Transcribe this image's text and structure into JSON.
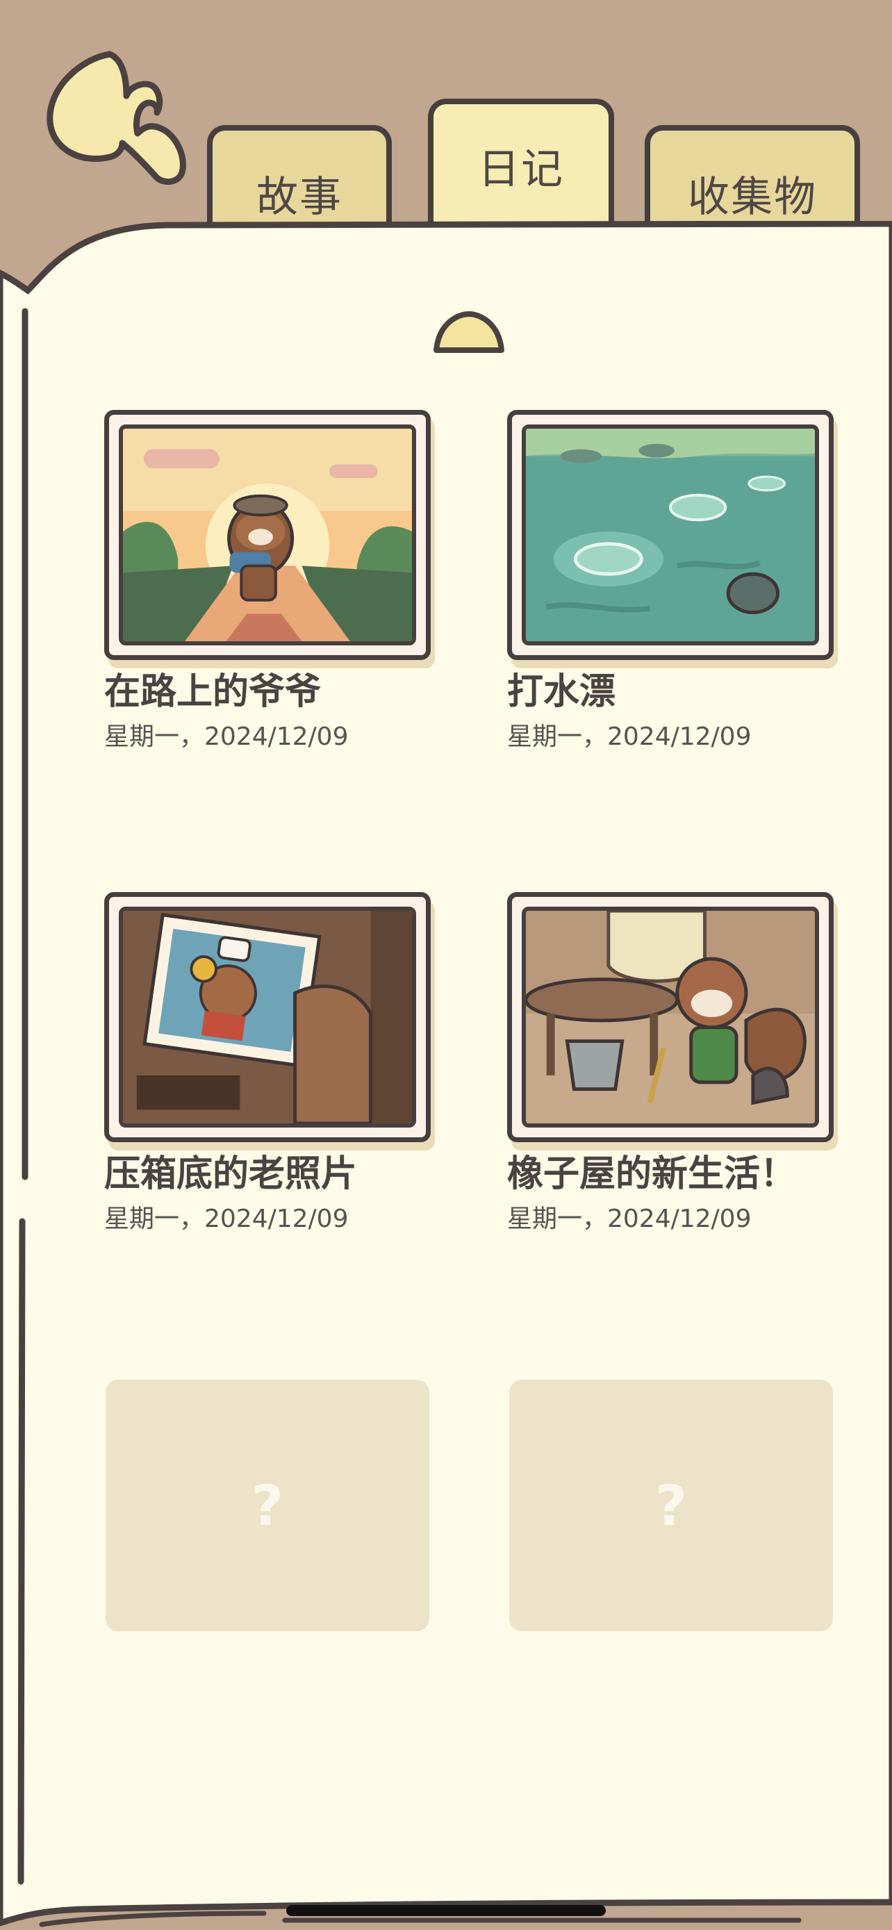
{
  "tabs": [
    {
      "label": "故事",
      "active": false
    },
    {
      "label": "日记",
      "active": true
    },
    {
      "label": "收集物",
      "active": false
    }
  ],
  "entries": [
    {
      "title": "在路上的爷爷",
      "date": "星期一，2024/12/09",
      "image": "grandpa-on-road"
    },
    {
      "title": "打水漂",
      "date": "星期一，2024/12/09",
      "image": "skipping-stones"
    },
    {
      "title": "压箱底的老照片",
      "date": "星期一，2024/12/09",
      "image": "old-photo"
    },
    {
      "title": "橡子屋的新生活！",
      "date": "星期一，2024/12/09",
      "image": "acorn-house"
    }
  ],
  "locked": [
    {
      "label": "?"
    },
    {
      "label": "?"
    }
  ],
  "colors": {
    "background": "#c1a690",
    "page": "#fefbe8",
    "tab_active": "#f7ecb3",
    "tab_inactive": "#e7d79b",
    "outline": "#463f3e",
    "locked_slot": "#ede3c8"
  }
}
